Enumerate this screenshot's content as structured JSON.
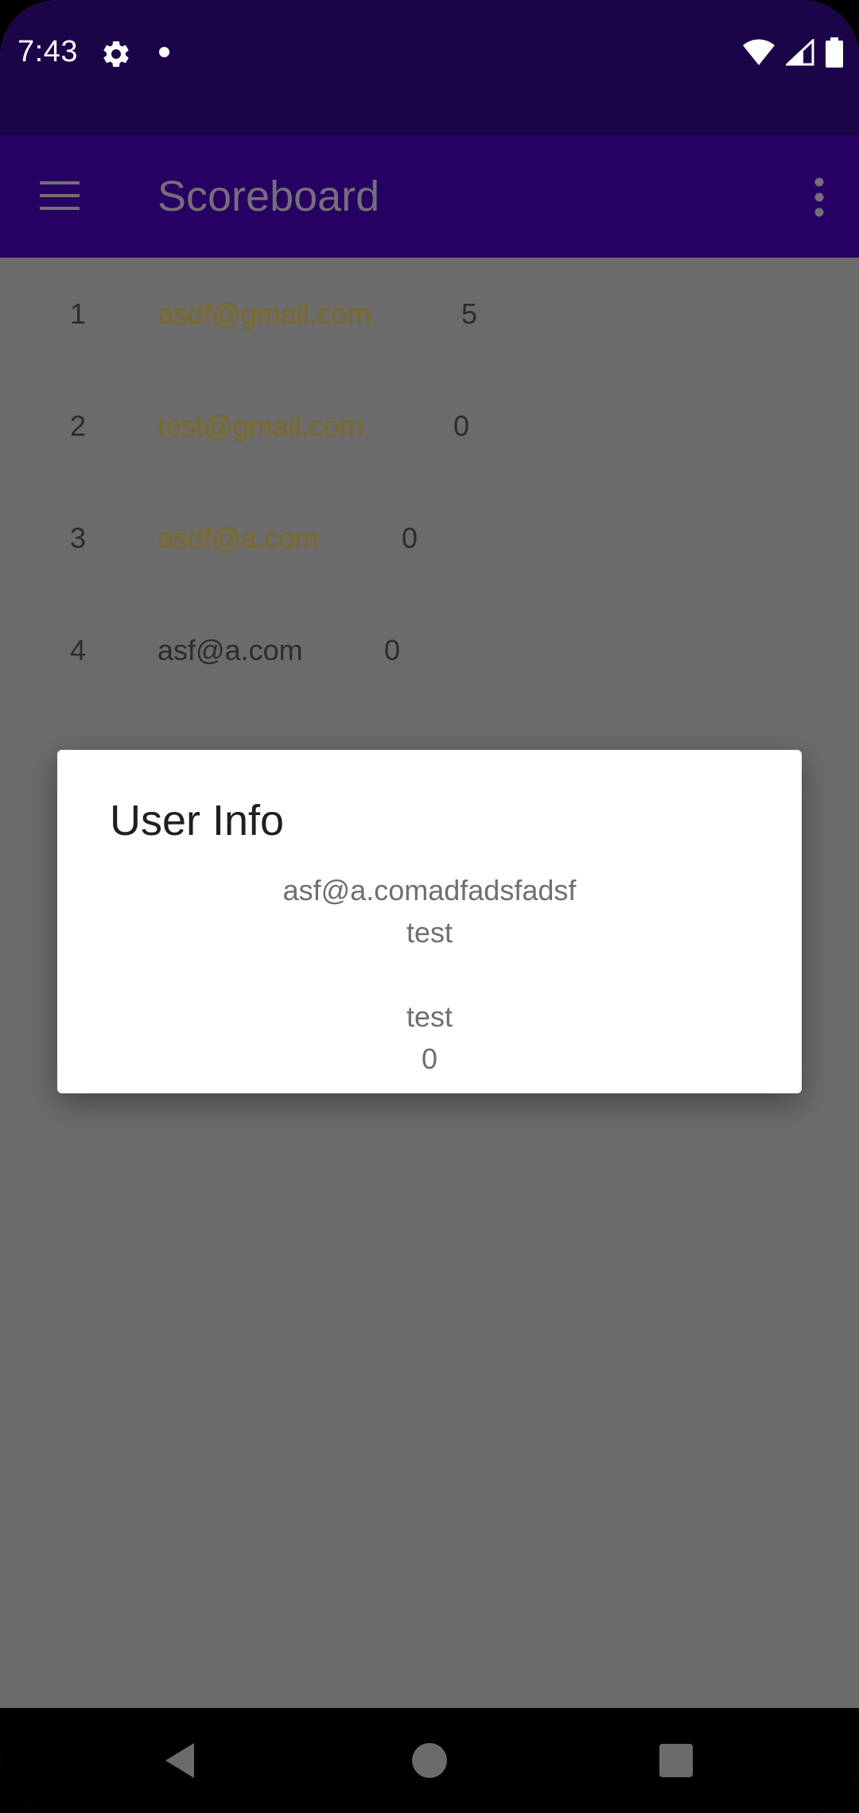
{
  "status_bar": {
    "time": "7:43",
    "icons": [
      "gear-icon",
      "notification-dot-icon",
      "wifi-icon",
      "signal-icon",
      "battery-icon"
    ]
  },
  "app_bar": {
    "title": "Scoreboard",
    "menu_icon": "menu-icon",
    "overflow_icon": "more-vert-icon"
  },
  "scoreboard": {
    "rows": [
      {
        "rank": "1",
        "email": "asdf@gmail.com",
        "score": "5"
      },
      {
        "rank": "2",
        "email": "test@gmail.com",
        "score": "0"
      },
      {
        "rank": "3",
        "email": "asdf@a.com",
        "score": "0"
      },
      {
        "rank": "4",
        "email": "asf@a.com",
        "score": "0"
      }
    ]
  },
  "dialog": {
    "title": "User Info",
    "lines": [
      "asf@a.comadfadsfadsf",
      "test",
      "",
      "test",
      "0"
    ]
  },
  "nav_bar": {
    "icons": [
      "back-icon",
      "home-icon",
      "recents-icon"
    ]
  },
  "colors": {
    "status_bar_bg": "#1c0449",
    "app_bar_bg": "#270063",
    "scrim_bg": "#6b6b6b",
    "link_email": "#7d6a1c",
    "plain_text": "#2c2c2c"
  }
}
